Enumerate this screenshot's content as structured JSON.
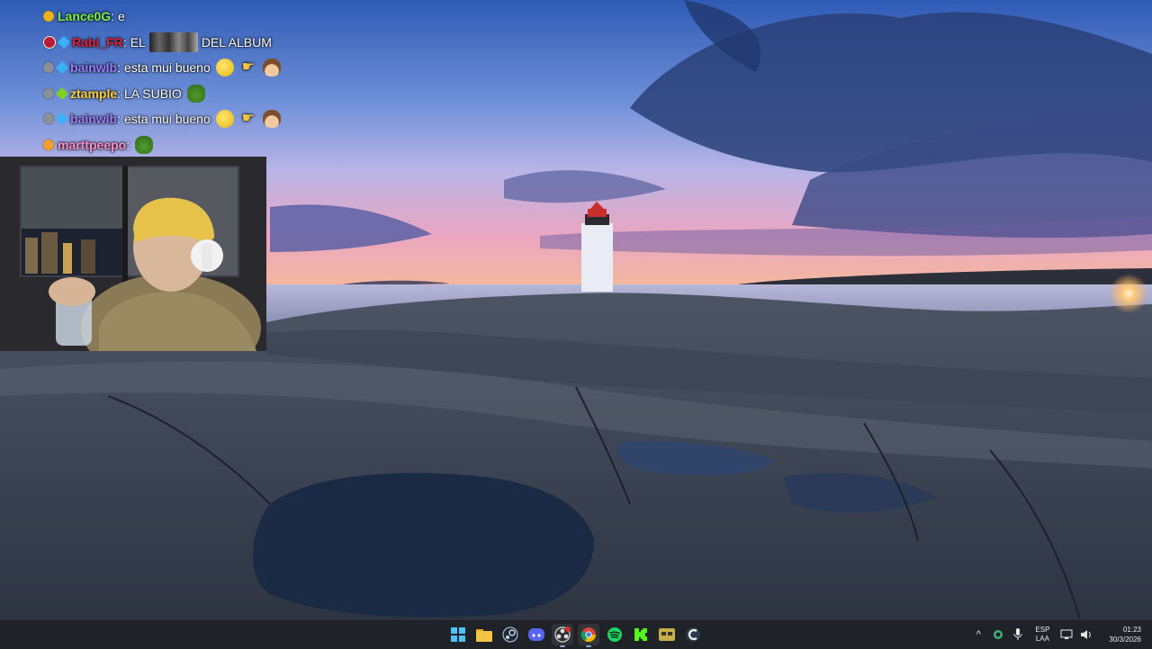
{
  "chat": {
    "messages": [
      {
        "user": "Lance0G",
        "user_color": "#7ef04a",
        "badge": "gold",
        "sub": "",
        "text": "e",
        "emotes": []
      },
      {
        "user": "Rabi_FR",
        "user_color": "#e0223b",
        "badge": "mod",
        "sub": "blue",
        "text_before": "EL",
        "text": "DEL ALBUM",
        "emotes": [
          "image-emote"
        ]
      },
      {
        "user": "bainwlb",
        "user_color": "#9a7cff",
        "badge": "gray",
        "sub": "blue",
        "text": "esta mui bueno",
        "emotes": [
          "yellow-emote",
          "pointing-hand-emote",
          "cowboy-emote"
        ]
      },
      {
        "user": "ztample",
        "user_color": "#ffcf3a",
        "badge": "gray",
        "sub": "green",
        "text": "LA SUBIO",
        "emotes": [
          "pepe-emote"
        ]
      },
      {
        "user": "bainwlb",
        "user_color": "#9a7cff",
        "badge": "gray",
        "sub": "blue",
        "text": "esta mui bueno",
        "emotes": [
          "yellow-emote",
          "pointing-hand-emote",
          "cowboy-emote"
        ]
      },
      {
        "user": "marttpeepo",
        "user_color": "#ff8fcf",
        "badge": "orange",
        "sub": "",
        "text": "",
        "emotes": [
          "pepe-emote"
        ]
      }
    ]
  },
  "taskbar": {
    "apps": [
      "windows-start-icon",
      "file-explorer-icon",
      "steam-icon",
      "discord-icon",
      "obs-icon",
      "chrome-icon",
      "spotify-icon",
      "kick-icon",
      "notes-app-icon",
      "ccleaner-icon"
    ],
    "tray": {
      "chevron": "^",
      "lang_top": "ESP",
      "lang_bottom": "LAA",
      "time": "01:23",
      "date": "30/3/2026"
    }
  },
  "colors": {
    "taskbar_bg": "#1f2328",
    "sky_top": "#3a63b8",
    "sunset": "#f0a3a8"
  }
}
